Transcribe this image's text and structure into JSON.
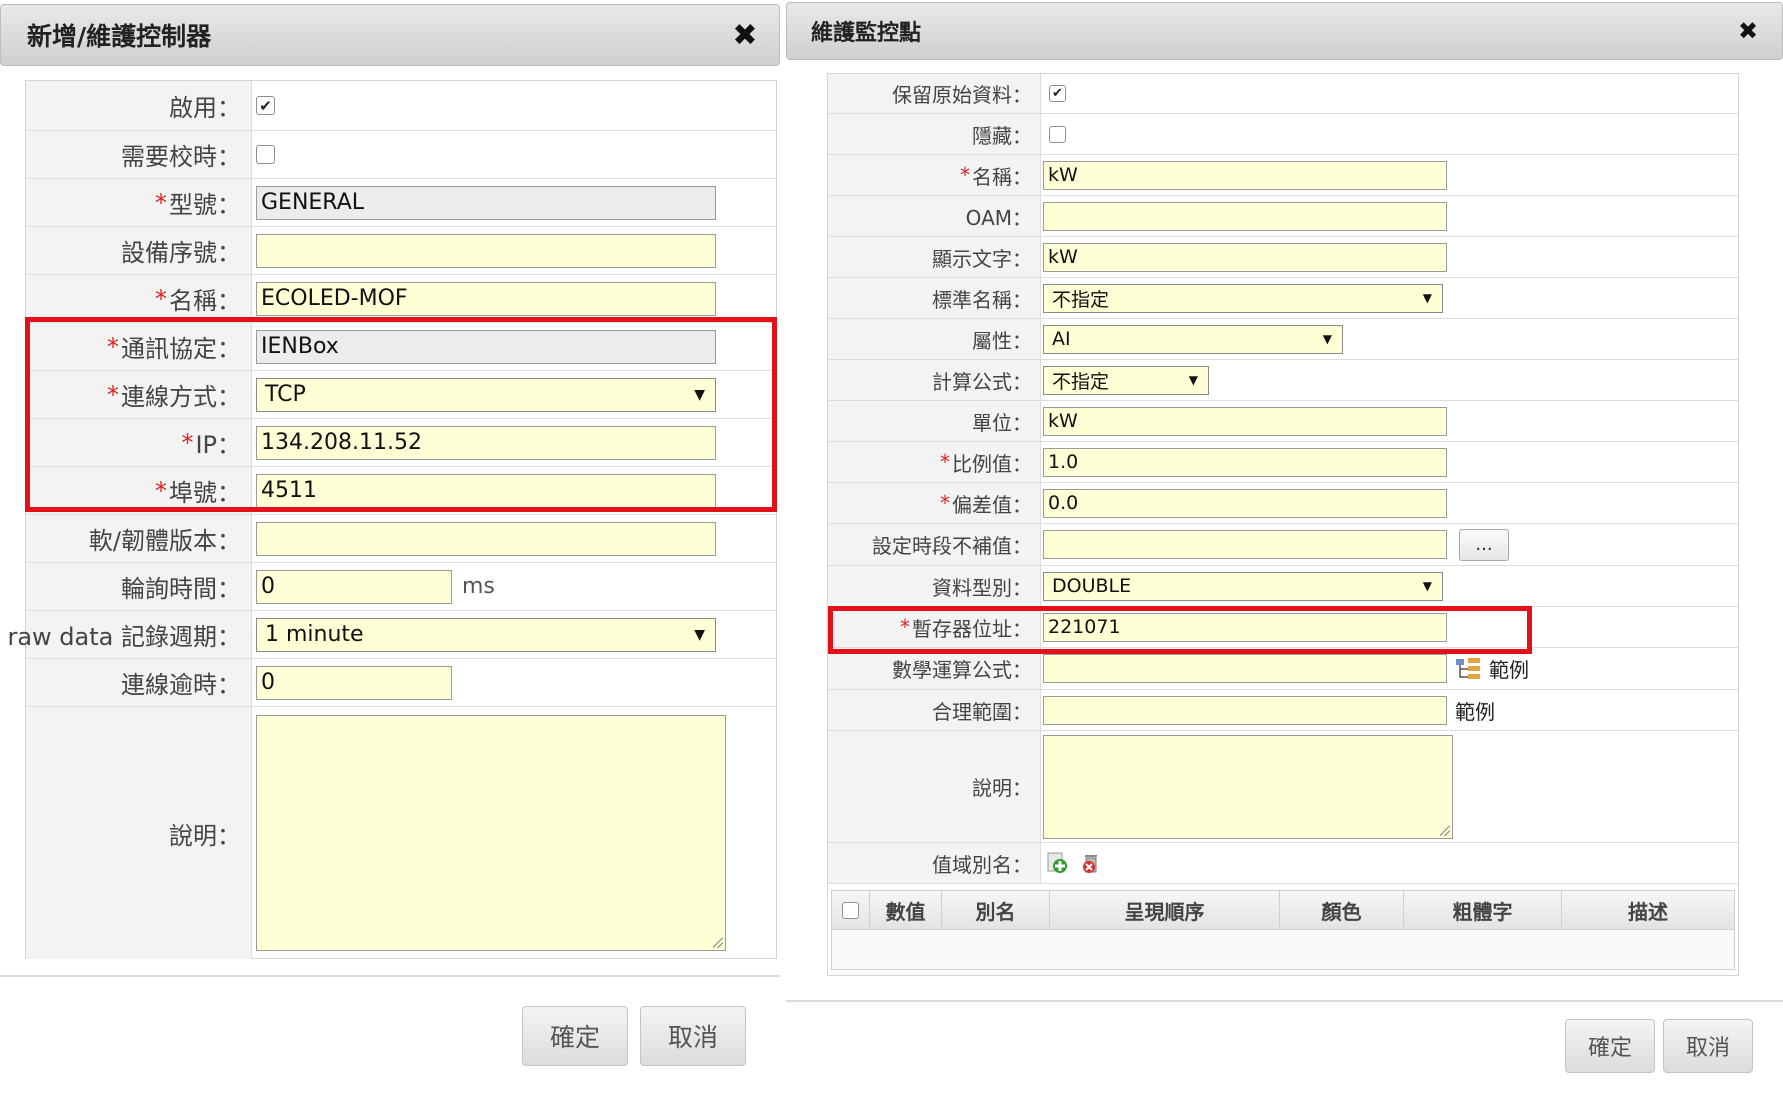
{
  "left": {
    "title": "新增/維護控制器",
    "close": "✖",
    "fields": {
      "enabled_label": "啟用：",
      "need_timesync_label": "需要校時：",
      "model_label": "型號：",
      "model_value": "GENERAL",
      "serial_label": "設備序號：",
      "serial_value": "",
      "name_label": "名稱：",
      "name_value": "ECOLED-MOF",
      "protocol_label": "通訊協定：",
      "protocol_value": "IENBox",
      "connection_label": "連線方式：",
      "connection_value": "TCP",
      "ip_label": "IP：",
      "ip_value": "134.208.11.52",
      "port_label": "埠號：",
      "port_value": "4511",
      "firmware_label": "軟/韌體版本：",
      "firmware_value": "",
      "poll_label": "輪詢時間：",
      "poll_value": "0",
      "poll_unit": "ms",
      "raw_label": "raw data 記錄週期：",
      "raw_value": "1 minute",
      "timeout_label": "連線逾時：",
      "timeout_value": "0",
      "desc_label": "說明："
    },
    "required_mark": "*",
    "ok_label": "確定",
    "cancel_label": "取消"
  },
  "right": {
    "title": "維護監控點",
    "close": "✖",
    "fields": {
      "keep_raw_label": "保留原始資料：",
      "hidden_label": "隱藏：",
      "name_label": "名稱：",
      "name_value": "kW",
      "oam_label": "OAM：",
      "oam_value": "",
      "display_label": "顯示文字：",
      "display_value": "kW",
      "std_name_label": "標準名稱：",
      "std_name_value": "不指定",
      "attr_label": "屬性：",
      "attr_value": "AI",
      "formula_label": "計算公式：",
      "formula_value": "不指定",
      "unit_label": "單位：",
      "unit_value": "kW",
      "ratio_label": "比例值：",
      "ratio_value": "1.0",
      "offset_label": "偏差值：",
      "offset_value": "0.0",
      "nofill_label": "設定時段不補值：",
      "nofill_value": "",
      "dots": "...",
      "dtype_label": "資料型別：",
      "dtype_value": "DOUBLE",
      "register_label": "暫存器位址：",
      "register_value": "221071",
      "math_label": "數學運算公式：",
      "math_value": "",
      "example_label": "範例",
      "range_label": "合理範圍：",
      "range_value": "",
      "desc_label": "說明：",
      "alias_label": "值域別名："
    },
    "grid_headers": [
      "數值",
      "別名",
      "呈現順序",
      "顏色",
      "粗體字",
      "描述"
    ],
    "required_mark": "*",
    "ok_label": "確定",
    "cancel_label": "取消"
  },
  "colors": {
    "input_bg": "#ffffd6",
    "readonly_bg": "#ececec",
    "highlight": "#e4101a",
    "required": "#e02020"
  }
}
